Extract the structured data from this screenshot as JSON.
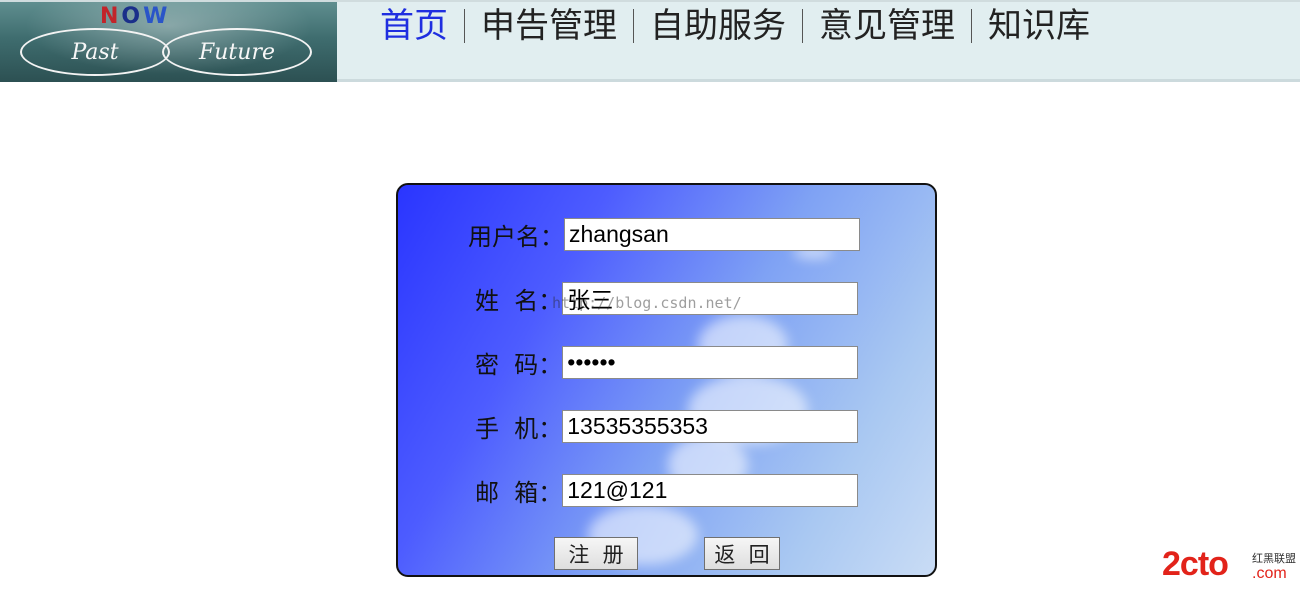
{
  "logo": {
    "now_letters": [
      "N",
      "O",
      "W"
    ],
    "left_word": "Past",
    "right_word": "Future"
  },
  "nav": {
    "items": [
      {
        "label": "首页",
        "active": true
      },
      {
        "label": "申告管理",
        "active": false
      },
      {
        "label": "自助服务",
        "active": false
      },
      {
        "label": "意见管理",
        "active": false
      },
      {
        "label": "知识库",
        "active": false
      }
    ]
  },
  "form": {
    "username": {
      "label": "用户名：",
      "value": "zhangsan"
    },
    "name": {
      "label": "姓  名：",
      "value": "张三"
    },
    "password": {
      "label": "密  码：",
      "value": "123456"
    },
    "phone": {
      "label": "手  机：",
      "value": "13535355353"
    },
    "email": {
      "label": "邮  箱：",
      "value": "121@121"
    },
    "register_label": "注  册",
    "back_label": "返  回"
  },
  "watermark": "http://blog.csdn.net/",
  "brand": {
    "main": "2cto",
    "tld": ".com",
    "sub": "红黑联盟"
  },
  "colors": {
    "nav_active": "#1f2ee0",
    "panel_start": "#2a35ff",
    "panel_end": "#c9dcf5",
    "brand": "#e2231a"
  }
}
